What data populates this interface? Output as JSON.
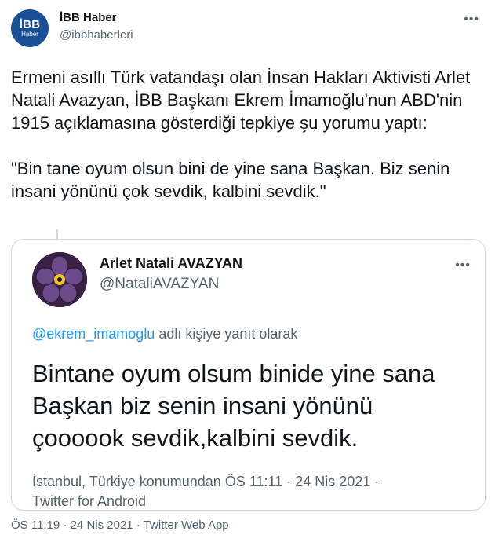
{
  "tweet": {
    "author": {
      "avatar_line1": "İBB",
      "avatar_line2": "Haber",
      "name": "İBB Haber",
      "handle": "@ibbhaberleri"
    },
    "more_label": "•••",
    "text": "Ermeni asıllı Türk vatandaşı olan  İnsan Hakları Aktivisti Arlet Natali Avazyan, İBB Başkanı Ekrem İmamoğlu'nun ABD'nin 1915 açıklamasına gösterdiği tepkiye şu yorumu yaptı:\n\n\"Bin tane oyum olsun bini de yine sana Başkan. Biz senin insani yönünü çok sevdik, kalbini sevdik.\"",
    "footer": "ÖS 11:19 · 24 Nis 2021 · Twitter Web App"
  },
  "quote": {
    "author": {
      "name": "Arlet Natali AVAZYAN",
      "handle": "@NataliAVAZYAN"
    },
    "more_label": "•••",
    "reply_mention": "@ekrem_imamoglu",
    "reply_suffix": " adlı kişiye yanıt olarak",
    "text": "Bintane oyum olsum binide yine sana Başkan biz senin insani yönünü çoooook sevdik,kalbini sevdik.",
    "meta": "İstanbul, Türkiye konumundan ÖS 11:11 · 24 Nis 2021 · Twitter for Android"
  },
  "colors": {
    "text": "#0f1419",
    "secondary": "#536471",
    "link": "#1d9bf0",
    "border": "#cfd9de",
    "brand": "#1a4f95",
    "flower_petal": "#6b4a8a",
    "flower_center": "#f2c230"
  }
}
